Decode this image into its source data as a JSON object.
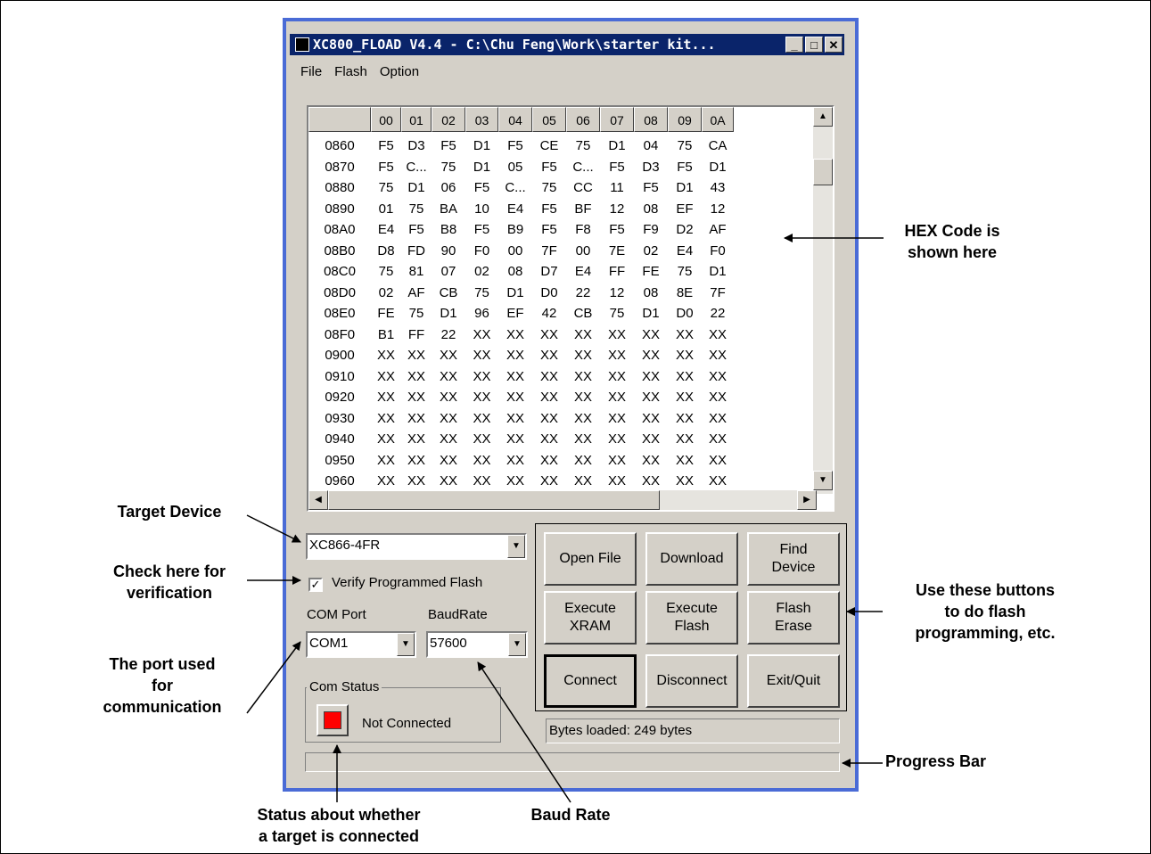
{
  "window": {
    "title": "XC800_FLOAD V4.4 - C:\\Chu Feng\\Work\\starter kit...",
    "min": "_",
    "max": "□",
    "close": "✕"
  },
  "menu": [
    "File",
    "Flash",
    "Option"
  ],
  "grid": {
    "columns": [
      "",
      "00",
      "01",
      "02",
      "03",
      "04",
      "05",
      "06",
      "07",
      "08",
      "09",
      "0A"
    ],
    "rows": [
      [
        "0860",
        "F5",
        "D3",
        "F5",
        "D1",
        "F5",
        "CE",
        "75",
        "D1",
        "04",
        "75",
        "CA"
      ],
      [
        "0870",
        "F5",
        "C...",
        "75",
        "D1",
        "05",
        "F5",
        "C...",
        "F5",
        "D3",
        "F5",
        "D1"
      ],
      [
        "0880",
        "75",
        "D1",
        "06",
        "F5",
        "C...",
        "75",
        "CC",
        "11",
        "F5",
        "D1",
        "43"
      ],
      [
        "0890",
        "01",
        "75",
        "BA",
        "10",
        "E4",
        "F5",
        "BF",
        "12",
        "08",
        "EF",
        "12"
      ],
      [
        "08A0",
        "E4",
        "F5",
        "B8",
        "F5",
        "B9",
        "F5",
        "F8",
        "F5",
        "F9",
        "D2",
        "AF"
      ],
      [
        "08B0",
        "D8",
        "FD",
        "90",
        "F0",
        "00",
        "7F",
        "00",
        "7E",
        "02",
        "E4",
        "F0"
      ],
      [
        "08C0",
        "75",
        "81",
        "07",
        "02",
        "08",
        "D7",
        "E4",
        "FF",
        "FE",
        "75",
        "D1"
      ],
      [
        "08D0",
        "02",
        "AF",
        "CB",
        "75",
        "D1",
        "D0",
        "22",
        "12",
        "08",
        "8E",
        "7F"
      ],
      [
        "08E0",
        "FE",
        "75",
        "D1",
        "96",
        "EF",
        "42",
        "CB",
        "75",
        "D1",
        "D0",
        "22"
      ],
      [
        "08F0",
        "B1",
        "FF",
        "22",
        "XX",
        "XX",
        "XX",
        "XX",
        "XX",
        "XX",
        "XX",
        "XX"
      ],
      [
        "0900",
        "XX",
        "XX",
        "XX",
        "XX",
        "XX",
        "XX",
        "XX",
        "XX",
        "XX",
        "XX",
        "XX"
      ],
      [
        "0910",
        "XX",
        "XX",
        "XX",
        "XX",
        "XX",
        "XX",
        "XX",
        "XX",
        "XX",
        "XX",
        "XX"
      ],
      [
        "0920",
        "XX",
        "XX",
        "XX",
        "XX",
        "XX",
        "XX",
        "XX",
        "XX",
        "XX",
        "XX",
        "XX"
      ],
      [
        "0930",
        "XX",
        "XX",
        "XX",
        "XX",
        "XX",
        "XX",
        "XX",
        "XX",
        "XX",
        "XX",
        "XX"
      ],
      [
        "0940",
        "XX",
        "XX",
        "XX",
        "XX",
        "XX",
        "XX",
        "XX",
        "XX",
        "XX",
        "XX",
        "XX"
      ],
      [
        "0950",
        "XX",
        "XX",
        "XX",
        "XX",
        "XX",
        "XX",
        "XX",
        "XX",
        "XX",
        "XX",
        "XX"
      ],
      [
        "0960",
        "XX",
        "XX",
        "XX",
        "XX",
        "XX",
        "XX",
        "XX",
        "XX",
        "XX",
        "XX",
        "XX"
      ]
    ]
  },
  "target_device": {
    "value": "XC866-4FR"
  },
  "verify": {
    "label": "Verify Programmed Flash",
    "checked": true
  },
  "com_port": {
    "label": "COM Port",
    "value": "COM1"
  },
  "baud_rate": {
    "label": "BaudRate",
    "value": "57600"
  },
  "com_status": {
    "title": "Com Status",
    "text": "Not Connected",
    "color": "#ff0000"
  },
  "buttons": {
    "open_file": "Open File",
    "download": "Download",
    "find_device": "Find\nDevice",
    "execute_xram": "Execute\nXRAM",
    "execute_flash": "Execute\nFlash",
    "flash_erase": "Flash\nErase",
    "connect": "Connect",
    "disconnect": "Disconnect",
    "exit_quit": "Exit/Quit"
  },
  "status_text": "Bytes loaded: 249 bytes",
  "annotations": {
    "hex_code": "HEX Code is\nshown here",
    "target_device": "Target Device",
    "verification": "Check here for\nverification",
    "port": "The port used\nfor\ncommunication",
    "buttons": "Use these buttons\nto do flash\nprogramming, etc.",
    "progress": "Progress Bar",
    "status": "Status about  whether\na target is connected",
    "baud": "Baud Rate"
  }
}
